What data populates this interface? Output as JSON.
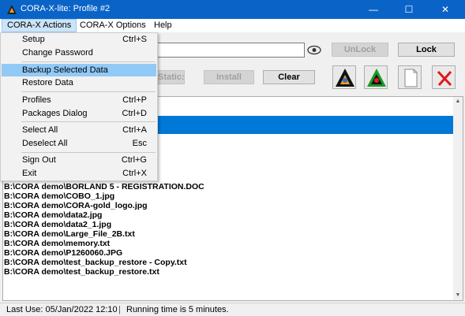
{
  "window": {
    "title": "CORA-X-lite:  Profile #2",
    "controls": {
      "minimize": "—",
      "maximize": "☐",
      "close": "✕"
    }
  },
  "menubar": [
    {
      "label": "CORA-X Actions"
    },
    {
      "label": "CORA-X Options"
    },
    {
      "label": "Help"
    }
  ],
  "actions_menu": [
    {
      "label": "Setup",
      "shortcut": "Ctrl+S"
    },
    {
      "label": "Change Password",
      "shortcut": ""
    },
    {
      "label": "Backup Selected Data",
      "shortcut": ""
    },
    {
      "label": "Restore Data",
      "shortcut": ""
    },
    {
      "label": "Profiles",
      "shortcut": "Ctrl+P"
    },
    {
      "label": "Packages Dialog",
      "shortcut": "Ctrl+D"
    },
    {
      "label": "Select All",
      "shortcut": "Ctrl+A"
    },
    {
      "label": "Deselect All",
      "shortcut": "Esc"
    },
    {
      "label": "Sign Out",
      "shortcut": "Ctrl+G"
    },
    {
      "label": "Exit",
      "shortcut": "Ctrl+X"
    }
  ],
  "toolbar": {
    "password_value": "",
    "unlock_label": "UnLock",
    "lock_label": "Lock",
    "static_label": "Static:",
    "install_label": "Install",
    "clear_label": "Clear",
    "icons": [
      "cora-logo-icon",
      "cora-green-logo-icon",
      "document-icon",
      "red-x-icon"
    ]
  },
  "file_list": [
    "B:\\CORA demo\\BORLAND 5 - REGISTRATION.DOC",
    "B:\\CORA demo\\COBO_1.jpg",
    "B:\\CORA demo\\CORA-gold_logo.jpg",
    "B:\\CORA demo\\data2.jpg",
    "B:\\CORA demo\\data2_1.jpg",
    "B:\\CORA demo\\Large_File_2B.txt",
    "B:\\CORA demo\\memory.txt",
    "B:\\CORA demo\\P1260060.JPG",
    "B:\\CORA demo\\test_backup_restore - Copy.txt",
    "B:\\CORA demo\\test_backup_restore.txt"
  ],
  "status": {
    "last_use": "Last Use: 05/Jan/2022  12:10",
    "separator": "|",
    "running": "Running time is 5 minutes."
  },
  "colors": {
    "titlebar": "#0a64c8",
    "selection": "#0078d7",
    "menu_highlight": "#91c9f7"
  }
}
